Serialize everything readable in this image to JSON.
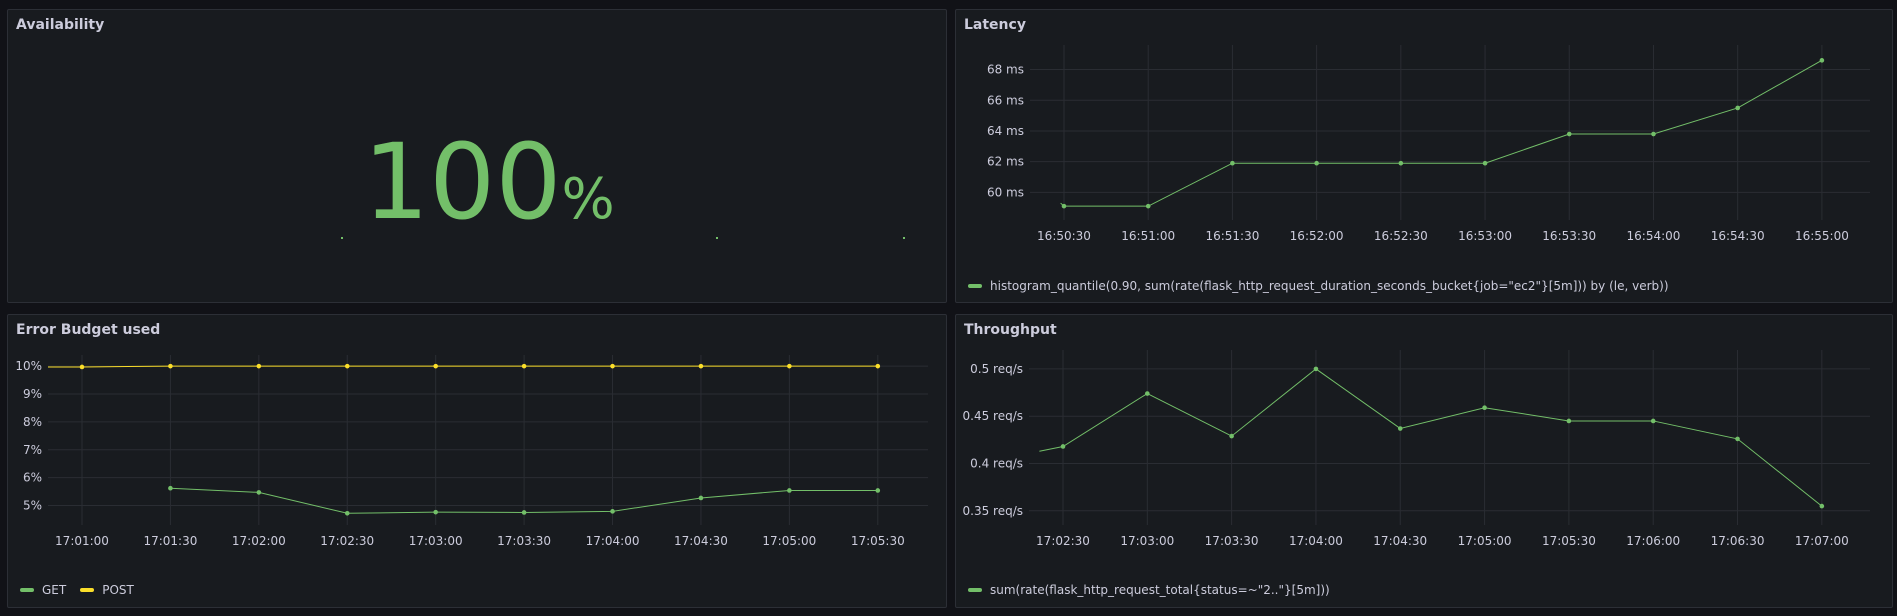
{
  "colors": {
    "green": "#73bf69",
    "yellow": "#fade2a",
    "background": "#111217",
    "panel": "#181b1f"
  },
  "panels": {
    "availability": {
      "title": "Availability",
      "value": "100",
      "unit": "%"
    },
    "latency": {
      "title": "Latency"
    },
    "error_budget": {
      "title": "Error Budget used"
    },
    "throughput": {
      "title": "Throughput"
    }
  },
  "chart_data": [
    {
      "id": "latency",
      "type": "line",
      "title": "Latency",
      "unit": "ms",
      "x": [
        "16:50:30",
        "16:51:00",
        "16:51:30",
        "16:52:00",
        "16:52:30",
        "16:53:00",
        "16:53:30",
        "16:54:00",
        "16:54:30",
        "16:55:00"
      ],
      "yticks": [
        60,
        62,
        64,
        66,
        68
      ],
      "ytick_labels": [
        "60 ms",
        "62 ms",
        "64 ms",
        "66 ms",
        "68 ms"
      ],
      "ylim": [
        58.2,
        69.6
      ],
      "grid": true,
      "legend_position": "bottom-left",
      "series": [
        {
          "name": "histogram_quantile(0.90, sum(rate(flask_http_request_duration_seconds_bucket{job=\"ec2\"}[5m])) by (le, verb))",
          "color": "#73bf69",
          "points": [
            [
              -0.04,
              59.3
            ],
            [
              0,
              59.1
            ],
            [
              1,
              59.1
            ],
            [
              2,
              61.9
            ],
            [
              3,
              61.9
            ],
            [
              4,
              61.9
            ],
            [
              5,
              61.9
            ],
            [
              6,
              63.8
            ],
            [
              7,
              63.8
            ],
            [
              8,
              65.5
            ],
            [
              9,
              68.6
            ]
          ]
        }
      ]
    },
    {
      "id": "error_budget",
      "type": "line",
      "title": "Error Budget used",
      "unit": "%",
      "x": [
        "17:01:00",
        "17:01:30",
        "17:02:00",
        "17:02:30",
        "17:03:00",
        "17:03:30",
        "17:04:00",
        "17:04:30",
        "17:05:00",
        "17:05:30"
      ],
      "yticks": [
        5,
        6,
        7,
        8,
        9,
        10
      ],
      "ytick_labels": [
        "5%",
        "6%",
        "7%",
        "8%",
        "9%",
        "10%"
      ],
      "ylim": [
        4.3,
        10.4
      ],
      "grid": true,
      "legend_position": "bottom-left",
      "series": [
        {
          "name": "GET",
          "color": "#73bf69",
          "points": [
            [
              1,
              5.62
            ],
            [
              2,
              5.47
            ],
            [
              3,
              4.72
            ],
            [
              4,
              4.76
            ],
            [
              5,
              4.75
            ],
            [
              6,
              4.79
            ],
            [
              7,
              5.27
            ],
            [
              8,
              5.54
            ],
            [
              9,
              5.54
            ]
          ]
        },
        {
          "name": "POST",
          "color": "#fade2a",
          "points": [
            [
              -0.69,
              9.97
            ],
            [
              0,
              9.97
            ],
            [
              1,
              10.0
            ],
            [
              2,
              10.0
            ],
            [
              3,
              10.0
            ],
            [
              4,
              10.0
            ],
            [
              5,
              10.0
            ],
            [
              6,
              10.0
            ],
            [
              7,
              10.0
            ],
            [
              8,
              10.0
            ],
            [
              9,
              10.0
            ]
          ]
        }
      ]
    },
    {
      "id": "throughput",
      "type": "line",
      "title": "Throughput",
      "unit": "req/s",
      "x": [
        "17:02:30",
        "17:03:00",
        "17:03:30",
        "17:04:00",
        "17:04:30",
        "17:05:00",
        "17:05:30",
        "17:06:00",
        "17:06:30",
        "17:07:00"
      ],
      "yticks": [
        0.35,
        0.4,
        0.45,
        0.5
      ],
      "ytick_labels": [
        "0.35 req/s",
        "0.4 req/s",
        "0.45 req/s",
        "0.5 req/s"
      ],
      "ylim": [
        0.335,
        0.52
      ],
      "grid": true,
      "legend_position": "bottom-left",
      "series": [
        {
          "name": "sum(rate(flask_http_request_total{status=~\"2..\"}[5m]))",
          "color": "#73bf69",
          "points": [
            [
              -0.28,
              0.413
            ],
            [
              0,
              0.418
            ],
            [
              1,
              0.474
            ],
            [
              2,
              0.429
            ],
            [
              3,
              0.5
            ],
            [
              4,
              0.437
            ],
            [
              5,
              0.459
            ],
            [
              6,
              0.445
            ],
            [
              7,
              0.445
            ],
            [
              8,
              0.426
            ],
            [
              9,
              0.355
            ]
          ]
        }
      ]
    }
  ]
}
